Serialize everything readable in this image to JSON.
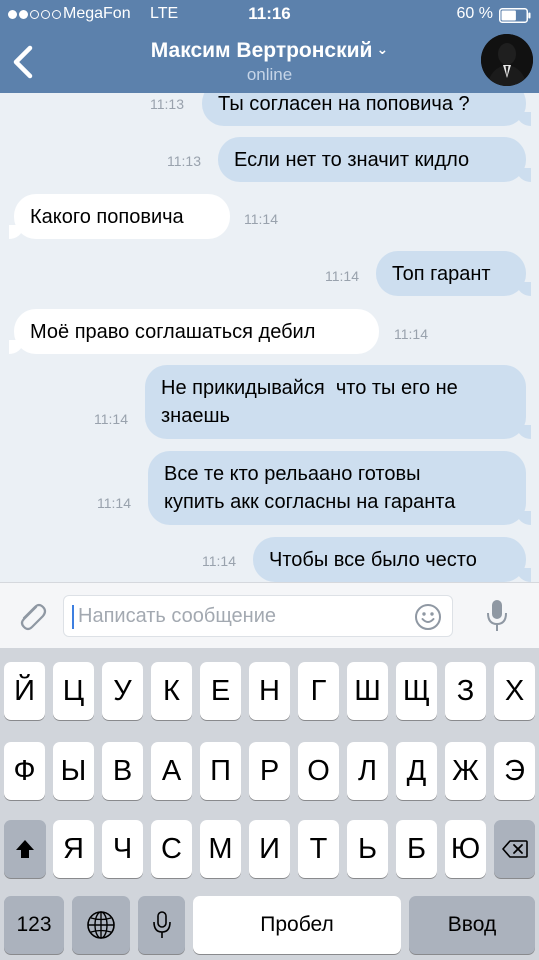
{
  "status_bar": {
    "signal_bars_filled": 2,
    "signal_bars_total": 5,
    "carrier": "MegaFon",
    "network": "LTE",
    "time": "11:16",
    "battery_percent": "60 %",
    "battery_level": 0.6
  },
  "header": {
    "contact_name": "Максим Вертронский",
    "chevron": "⌄",
    "status": "online",
    "colors": {
      "bar": "#5c81ac"
    }
  },
  "messages": [
    {
      "dir": "out",
      "text": "Ты согласен на поповича ?",
      "time": "11:13"
    },
    {
      "dir": "out",
      "text": "Если нет то значит кидло",
      "time": "11:13"
    },
    {
      "dir": "in",
      "text": "Какого поповича",
      "time": "11:14"
    },
    {
      "dir": "out",
      "text": "Топ гарант",
      "time": "11:14"
    },
    {
      "dir": "in",
      "text": "Моё право соглашаться дебил",
      "time": "11:14"
    },
    {
      "dir": "out",
      "lines": [
        "Не прикидывайся  что ты его не",
        "знаешь"
      ],
      "time": "11:14"
    },
    {
      "dir": "out",
      "lines": [
        "Все те кто рельаано готовы",
        "купить акк согласны на гаранта"
      ],
      "time": "11:14"
    },
    {
      "dir": "out",
      "text": "Чтобы все было често",
      "time": "11:14"
    }
  ],
  "input": {
    "placeholder": "Написать сообщение",
    "icons": {
      "attach": "paperclip-icon",
      "emoji": "smiley-icon",
      "mic": "microphone-icon"
    }
  },
  "keyboard": {
    "row1": [
      "Й",
      "Ц",
      "У",
      "К",
      "Е",
      "Н",
      "Г",
      "Ш",
      "Щ",
      "З",
      "Х"
    ],
    "row2": [
      "Ф",
      "Ы",
      "В",
      "А",
      "П",
      "Р",
      "О",
      "Л",
      "Д",
      "Ж",
      "Э"
    ],
    "row3": [
      "Я",
      "Ч",
      "С",
      "М",
      "И",
      "Т",
      "Ь",
      "Б",
      "Ю"
    ],
    "numbers_key": "123",
    "space_key": "Пробел",
    "return_key": "Ввод",
    "icons": {
      "shift": "shift-arrow-icon",
      "delete": "backspace-icon",
      "globe": "globe-icon",
      "dictation": "microphone-icon"
    }
  }
}
